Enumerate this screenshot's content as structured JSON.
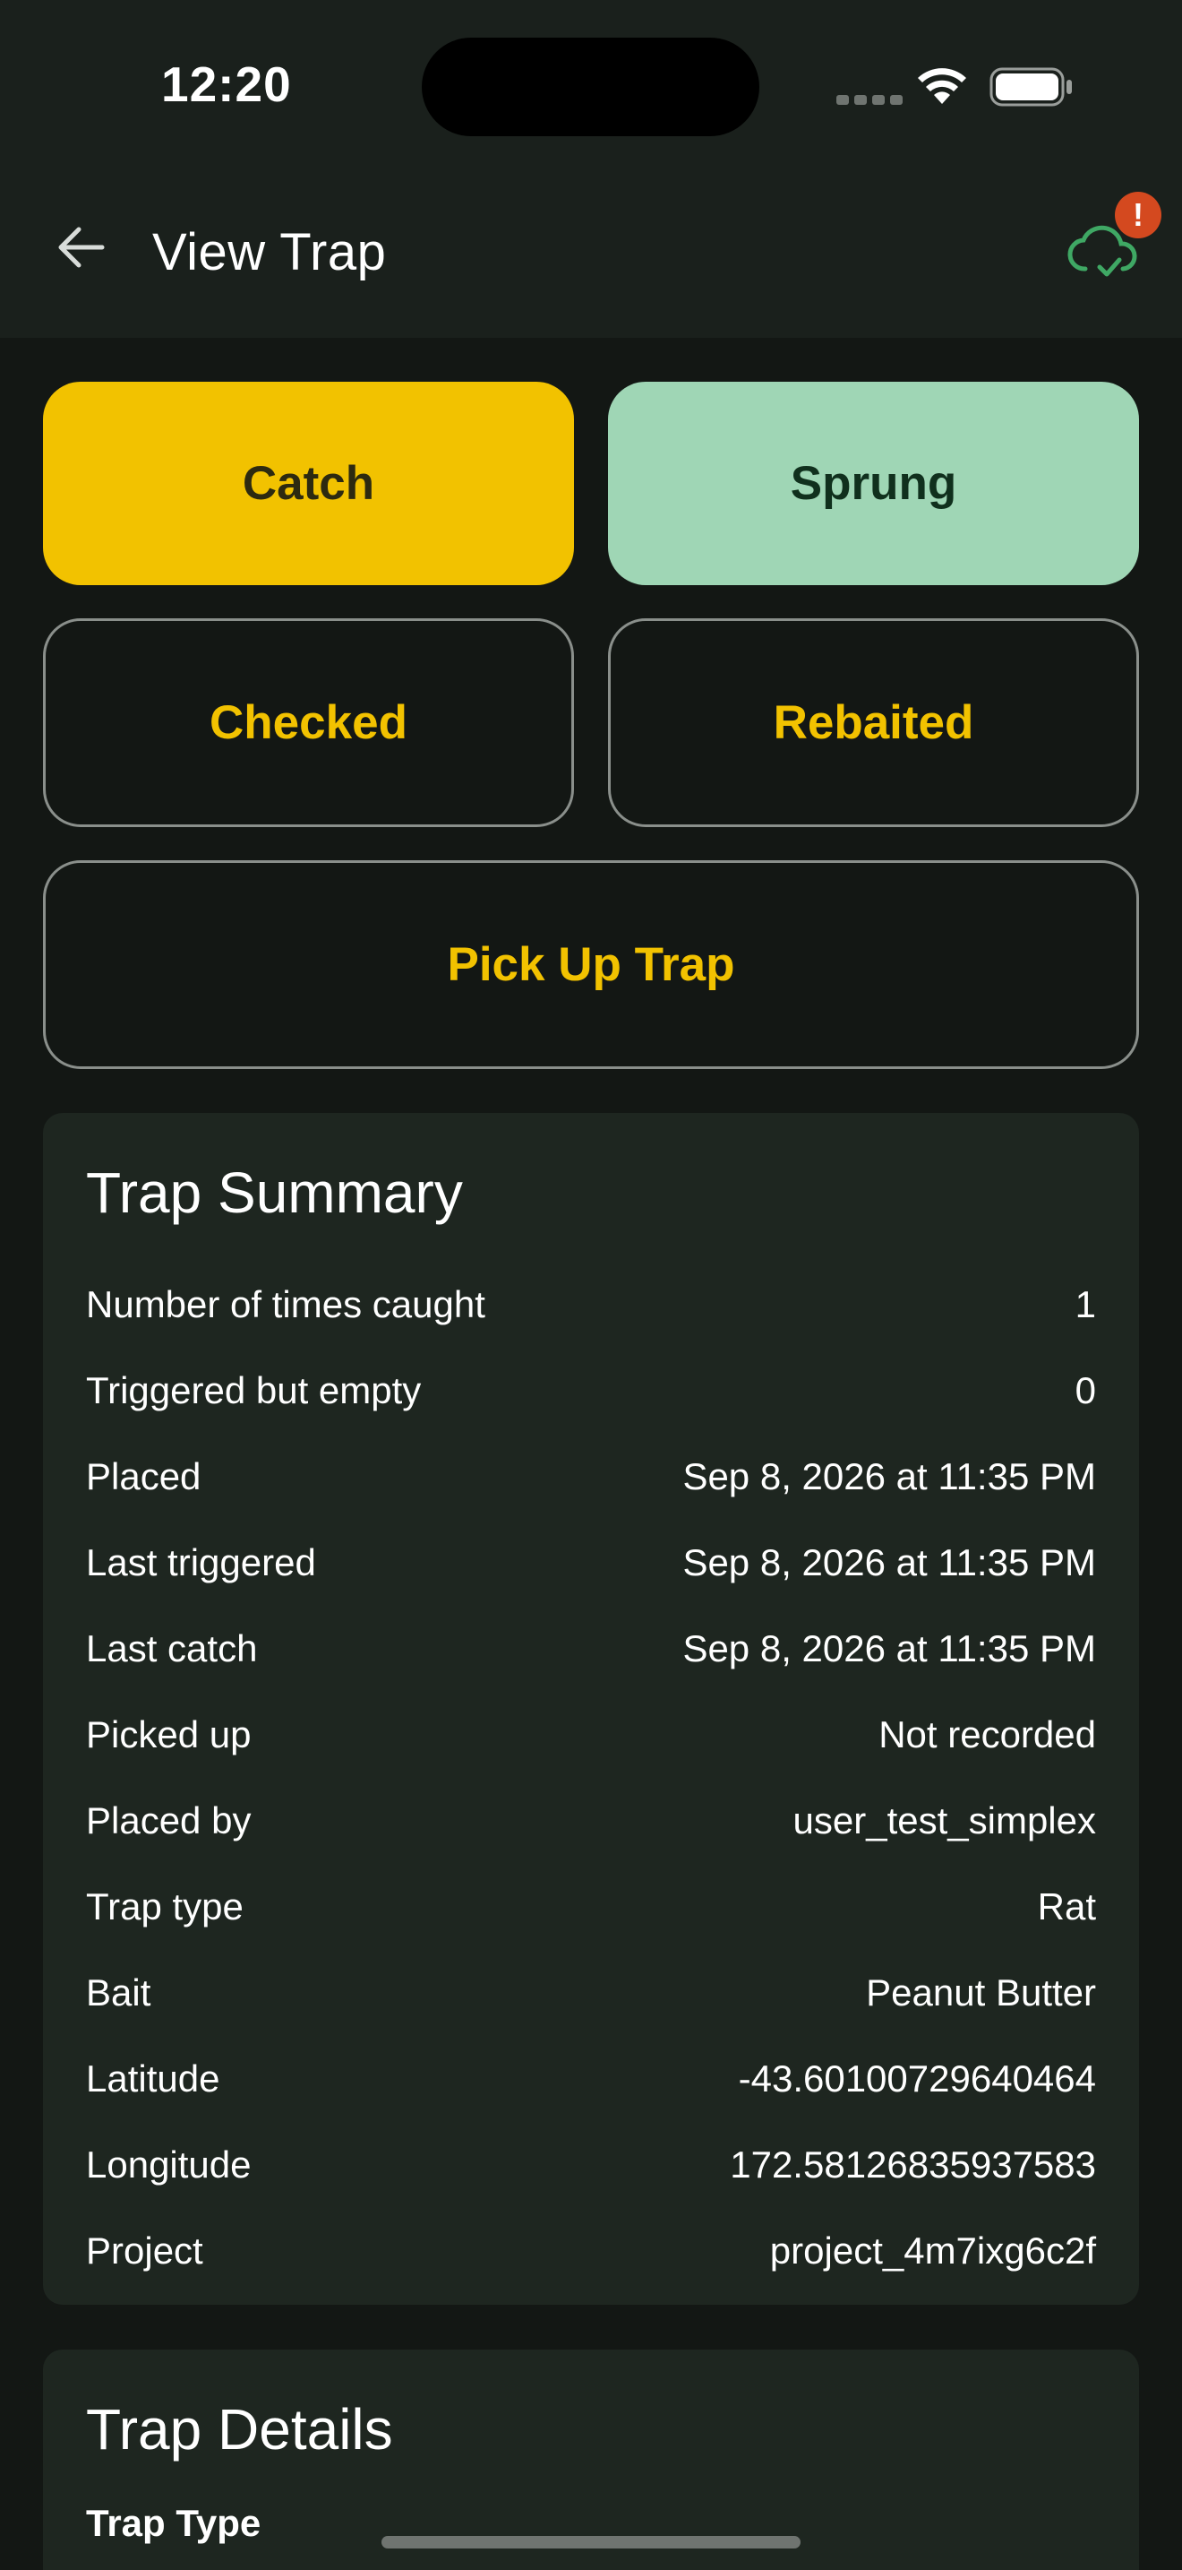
{
  "status_bar": {
    "time": "12:20"
  },
  "app_bar": {
    "title": "View Trap",
    "alert_badge": "!"
  },
  "actions": {
    "catch": "Catch",
    "sprung": "Sprung",
    "checked": "Checked",
    "rebaited": "Rebaited",
    "pick_up": "Pick Up Trap"
  },
  "summary": {
    "title": "Trap Summary",
    "rows": [
      {
        "label": "Number of times caught",
        "value": "1"
      },
      {
        "label": "Triggered but empty",
        "value": "0"
      },
      {
        "label": "Placed",
        "value": "Sep 8, 2026 at 11:35 PM"
      },
      {
        "label": "Last triggered",
        "value": "Sep 8, 2026 at 11:35 PM"
      },
      {
        "label": "Last catch",
        "value": "Sep 8, 2026 at 11:35 PM"
      },
      {
        "label": "Picked up",
        "value": "Not recorded"
      },
      {
        "label": "Placed by",
        "value": "user_test_simplex"
      },
      {
        "label": "Trap type",
        "value": "Rat"
      },
      {
        "label": "Bait",
        "value": "Peanut Butter"
      },
      {
        "label": "Latitude",
        "value": "-43.60100729640464"
      },
      {
        "label": "Longitude",
        "value": "172.58126835937583"
      },
      {
        "label": "Project",
        "value": "project_4m7ixg6c2f"
      }
    ]
  },
  "details": {
    "title": "Trap Details",
    "subheading": "Trap Type"
  },
  "colors": {
    "accent_yellow": "#f2c200",
    "sprung_green": "#9fd6b5",
    "alert_orange": "#d4491f",
    "sync_green": "#3fa864"
  },
  "icons": [
    "back-arrow-icon",
    "cloud-sync-check-icon",
    "wifi-icon",
    "battery-icon"
  ]
}
